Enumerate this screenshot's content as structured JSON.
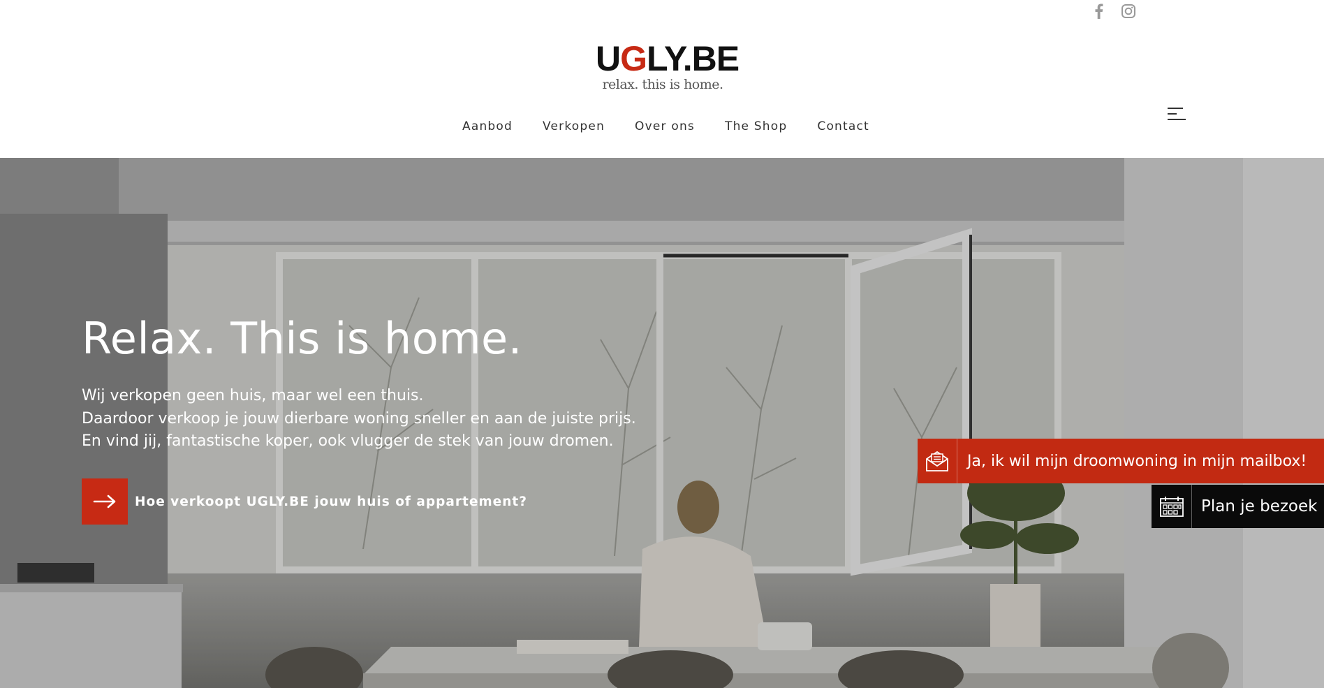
{
  "brand": {
    "logo_prefix": "U",
    "logo_accent": "G",
    "logo_suffix": "LY.BE",
    "tagline": "relax. this is home.",
    "accent_color": "#c72a14"
  },
  "social": [
    {
      "icon": "facebook-icon"
    },
    {
      "icon": "instagram-icon"
    }
  ],
  "nav": {
    "items": [
      "Aanbod",
      "Verkopen",
      "Over ons",
      "The Shop",
      "Contact"
    ],
    "menu_icon": "hamburger-menu-icon"
  },
  "hero": {
    "title": "Relax. This is home.",
    "lines": [
      "Wij verkopen geen huis, maar wel een thuis.",
      "Daardoor verkoop je jouw dierbare woning sneller en aan de juiste prijs.",
      "En vind jij, fantastische koper, ook vlugger de stek van jouw dromen."
    ],
    "cta_label": "Hoe verkoopt UGLY.BE jouw huis of appartement?",
    "cta_icon": "arrow-right-icon"
  },
  "floating": {
    "mailbox_label": "Ja, ik wil mijn droomwoning in mijn mailbox!",
    "mailbox_icon": "envelope-icon",
    "visit_label": "Plan je bezoek",
    "visit_icon": "calendar-icon"
  }
}
